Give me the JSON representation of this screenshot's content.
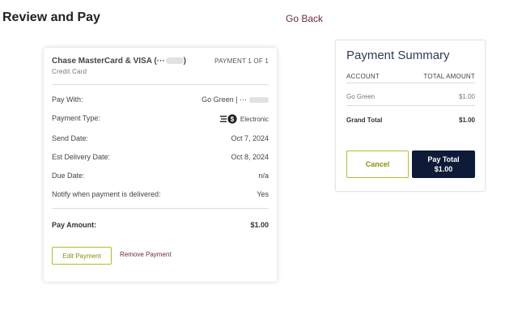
{
  "header": {
    "title": "Review and Pay",
    "go_back": "Go Back"
  },
  "payment": {
    "card_name": "Chase MasterCard & VISA (···",
    "card_name_suffix": ")",
    "card_type": "Credit Card",
    "counter": "PAYMENT 1 OF 1",
    "rows": [
      {
        "label": "Pay With:",
        "value": "Go Green | ···"
      },
      {
        "label": "Payment Type:",
        "value": "Electronic",
        "icon": "electronic-payment-icon"
      },
      {
        "label": "Send Date:",
        "value": "Oct 7, 2024"
      },
      {
        "label": "Est Delivery Date:",
        "value": "Oct 8, 2024"
      },
      {
        "label": "Due Date:",
        "value": "n/a"
      },
      {
        "label": "Notify when payment is delivered:",
        "value": "Yes"
      }
    ],
    "amount_label": "Pay Amount:",
    "amount_value": "$1.00",
    "edit_label": "Edit Payment",
    "remove_label": "Remove Payment"
  },
  "summary": {
    "title": "Payment Summary",
    "col_account": "ACCOUNT",
    "col_total": "TOTAL AMOUNT",
    "items": [
      {
        "account": "Go Green",
        "amount": "$1.00"
      }
    ],
    "grand_total_label": "Grand Total",
    "grand_total_value": "$1.00",
    "cancel_label": "Cancel",
    "pay_total_label": "Pay Total",
    "pay_total_amount": "$1.00"
  },
  "colors": {
    "accent_olive": "#b5bd2a",
    "link_maroon": "#6b2a45",
    "navy": "#0e1b38"
  }
}
